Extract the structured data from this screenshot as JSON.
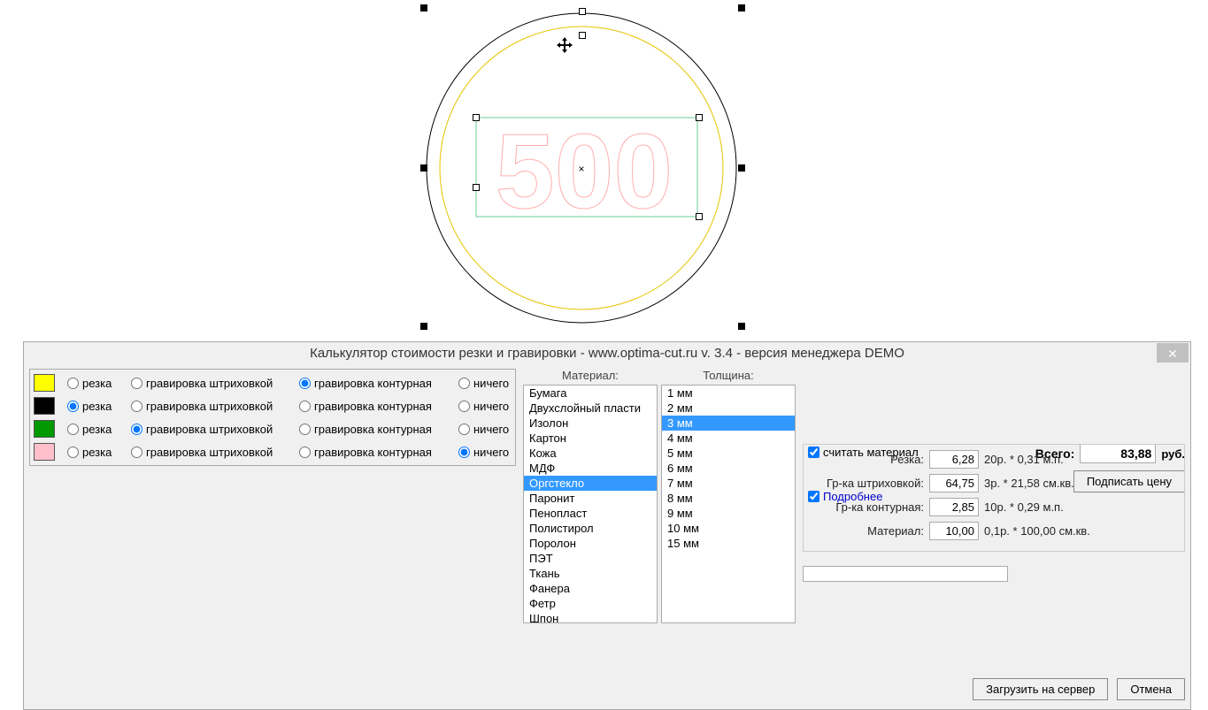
{
  "canvas": {
    "text": "500"
  },
  "dialog": {
    "title": "Калькулятор стоимости резки и гравировки - www.optima-cut.ru v. 3.4 - версия менеджера DEMO",
    "close": "✕"
  },
  "radio_labels": {
    "cut": "резка",
    "hatch": "гравировка штриховкой",
    "contour": "гравировка контурная",
    "none": "ничего"
  },
  "color_rows": [
    {
      "color": "#ffff00",
      "selected": "contour"
    },
    {
      "color": "#000000",
      "selected": "cut"
    },
    {
      "color": "#009900",
      "selected": "hatch"
    },
    {
      "color": "#ffc0cb",
      "selected": "none"
    }
  ],
  "material": {
    "header": "Материал:",
    "items": [
      "Бумага",
      "Двухслойный пласти",
      "Изолон",
      "Картон",
      "Кожа",
      "МДФ",
      "Оргстекло",
      "Паронит",
      "Пенопласт",
      "Полистирол",
      "Поролон",
      "ПЭТ",
      "Ткань",
      "Фанера",
      "Фетр",
      "Шпон"
    ],
    "selected": "Оргстекло"
  },
  "thickness": {
    "header": "Толщина:",
    "items": [
      "1 мм",
      "2 мм",
      "3 мм",
      "4 мм",
      "5 мм",
      "6 мм",
      "7 мм",
      "8 мм",
      "9 мм",
      "10 мм",
      "15 мм"
    ],
    "selected": "3 мм"
  },
  "right": {
    "count_material": "считать материал",
    "details": "Подробнее",
    "total_label": "Всего:",
    "total_value": "83,88",
    "total_unit": "руб.",
    "sign_price": "Подписать цену",
    "rows": {
      "cut": {
        "label": "Резка:",
        "value": "6,28",
        "expr": "20р. * 0,31 м.п."
      },
      "hatch": {
        "label": "Гр-ка штриховкой:",
        "value": "64,75",
        "expr": "3р. * 21,58 см.кв."
      },
      "contour": {
        "label": "Гр-ка контурная:",
        "value": "2,85",
        "expr": "10р. * 0,29 м.п."
      },
      "material": {
        "label": "Материал:",
        "value": "10,00",
        "expr": "0,1р. * 100,00 см.кв."
      }
    },
    "upload": "Загрузить на сервер",
    "cancel": "Отмена"
  }
}
